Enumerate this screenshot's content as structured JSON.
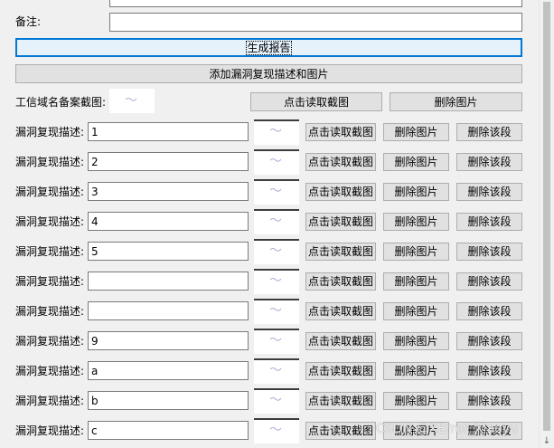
{
  "form": {
    "remarks_label": "备注:",
    "remarks_value": "",
    "generate_button": "生成报告",
    "add_button": "添加漏洞复现描述和图片",
    "icp_label": "工信域名备案截图:",
    "icp_read_button": "点击读取截图",
    "icp_delete_button": "删除图片"
  },
  "rows": [
    {
      "label": "漏洞复现描述:",
      "value": "1",
      "read": "点击读取截图",
      "del_img": "删除图片",
      "del_seg": "删除该段"
    },
    {
      "label": "漏洞复现描述:",
      "value": "2",
      "read": "点击读取截图",
      "del_img": "删除图片",
      "del_seg": "删除该段"
    },
    {
      "label": "漏洞复现描述:",
      "value": "3",
      "read": "点击读取截图",
      "del_img": "删除图片",
      "del_seg": "删除该段"
    },
    {
      "label": "漏洞复现描述:",
      "value": "4",
      "read": "点击读取截图",
      "del_img": "删除图片",
      "del_seg": "删除该段"
    },
    {
      "label": "漏洞复现描述:",
      "value": "5",
      "read": "点击读取截图",
      "del_img": "删除图片",
      "del_seg": "删除该段"
    },
    {
      "label": "漏洞复现描述:",
      "value": "",
      "read": "点击读取截图",
      "del_img": "删除图片",
      "del_seg": "删除该段"
    },
    {
      "label": "漏洞复现描述:",
      "value": "",
      "read": "点击读取截图",
      "del_img": "删除图片",
      "del_seg": "删除该段"
    },
    {
      "label": "漏洞复现描述:",
      "value": "9",
      "read": "点击读取截图",
      "del_img": "删除图片",
      "del_seg": "删除该段"
    },
    {
      "label": "漏洞复现描述:",
      "value": "a",
      "read": "点击读取截图",
      "del_img": "删除图片",
      "del_seg": "删除该段"
    },
    {
      "label": "漏洞复现描述:",
      "value": "b",
      "read": "点击读取截图",
      "del_img": "删除图片",
      "del_seg": "删除该段"
    },
    {
      "label": "漏洞复现描述:",
      "value": "c",
      "read": "点击读取截图",
      "del_img": "删除图片",
      "del_seg": "删除该段"
    }
  ],
  "watermark": "CSDN @XError_Xiaoyu",
  "colors": {
    "window_bg": "#f0f0f0",
    "button_bg": "#e1e1e1",
    "focus_border": "#0078d7"
  }
}
